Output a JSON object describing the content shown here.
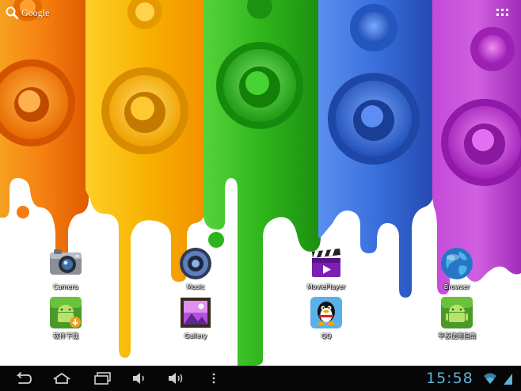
{
  "search": {
    "label": "Google"
  },
  "apps": [
    {
      "label": "Camera",
      "icon": "camera-icon"
    },
    {
      "label": "Music",
      "icon": "music-speaker-icon"
    },
    {
      "label": "MoviePlayer",
      "icon": "clapperboard-icon"
    },
    {
      "label": "Browser",
      "icon": "globe-icon"
    },
    {
      "label": "软件下载",
      "icon": "android-download-icon"
    },
    {
      "label": "Gallery",
      "icon": "gallery-frame-icon"
    },
    {
      "label": "QQ",
      "icon": "qq-penguin-icon"
    },
    {
      "label": "平板使用指南",
      "icon": "android-guide-icon"
    }
  ],
  "navbar": {
    "buttons": [
      "back-icon",
      "home-icon",
      "recent-apps-icon",
      "volume-down-icon",
      "volume-up-icon",
      "menu-icon"
    ],
    "clock": "15:58",
    "status": [
      "wifi-icon",
      "battery-icon"
    ]
  },
  "colors": {
    "orange": "#f47c10",
    "yellow": "#f5b300",
    "green": "#2bb51c",
    "blue": "#2e6bd6",
    "purple": "#c03ad0",
    "clock": "#5fb0d6",
    "navbar": "#060606"
  }
}
